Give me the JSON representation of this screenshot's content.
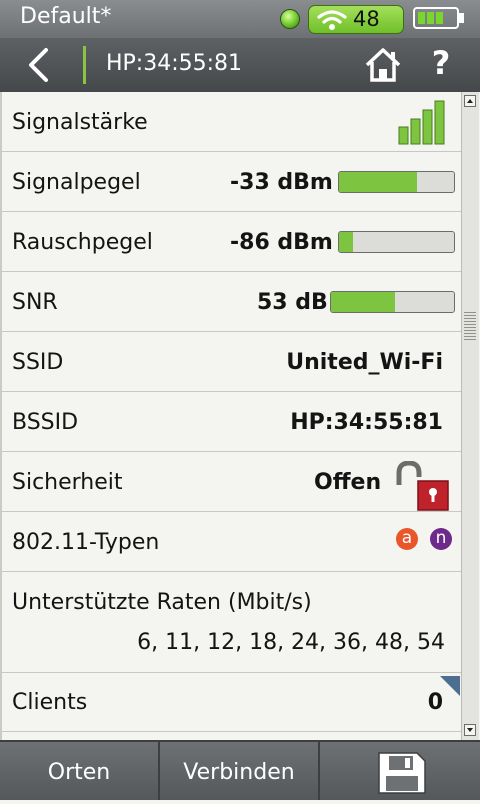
{
  "status": {
    "profile": "Default*",
    "wifi_count": "48",
    "battery_level": 0.75,
    "wifi_pill_color": "#7cc63a"
  },
  "header": {
    "title": "HP:34:55:81",
    "back_icon": "chevron-left-icon",
    "home_icon": "home-icon",
    "help_label": "?"
  },
  "rows": {
    "signal_strength": {
      "label": "Signalstärke",
      "level_bars": 4,
      "level_max": 4
    },
    "signal_level": {
      "label": "Signalpegel",
      "value": "-33 dBm",
      "fill": 0.68
    },
    "noise_level": {
      "label": "Rauschpegel",
      "value": "-86 dBm",
      "fill": 0.12
    },
    "snr": {
      "label": "SNR",
      "value": "53 dB",
      "fill": 0.52
    },
    "ssid": {
      "label": "SSID",
      "value": "United_Wi-Fi"
    },
    "bssid": {
      "label": "BSSID",
      "value": "HP:34:55:81"
    },
    "security": {
      "label": "Sicherheit",
      "value": "Offen",
      "icon": "open-lock-icon"
    },
    "types": {
      "label": "802.11-Typen",
      "badges": [
        "a",
        "n"
      ],
      "badge_colors": [
        "#e8562a",
        "#6d2a8a"
      ]
    },
    "rates": {
      "label": "Unterstützte Raten (Mbit/s)",
      "value": "6, 11, 12, 18, 24, 36, 48, 54"
    },
    "clients": {
      "label": "Clients",
      "value": "0"
    }
  },
  "bottom": {
    "locate_label": "Orten",
    "connect_label": "Verbinden",
    "save_icon": "save-icon"
  },
  "colors": {
    "accent_green": "#7dc540",
    "lock_red": "#c0222b"
  }
}
